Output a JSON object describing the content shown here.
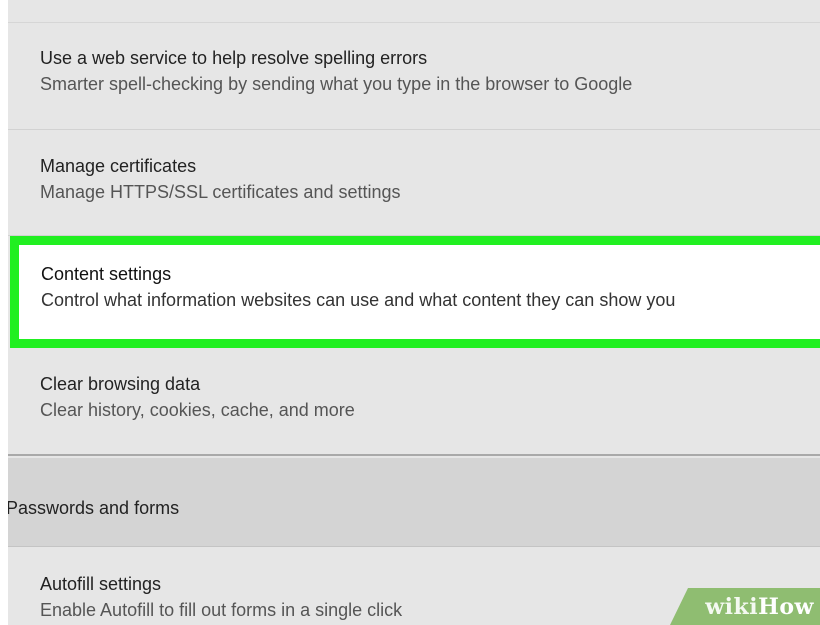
{
  "settings": {
    "spellcheck": {
      "title": "Use a web service to help resolve spelling errors",
      "subtitle": "Smarter spell-checking by sending what you type in the browser to Google"
    },
    "certificates": {
      "title": "Manage certificates",
      "subtitle": "Manage HTTPS/SSL certificates and settings"
    },
    "content_settings": {
      "title": "Content settings",
      "subtitle": "Control what information websites can use and what content they can show you",
      "highlight_color": "#21ef21"
    },
    "clear_browsing": {
      "title": "Clear browsing data",
      "subtitle": "Clear history, cookies, cache, and more"
    }
  },
  "passwords_section": {
    "title": "Passwords and forms",
    "autofill": {
      "title": "Autofill settings",
      "subtitle": "Enable Autofill to fill out forms in a single click"
    }
  },
  "watermark": {
    "part1": "wiki",
    "part2": "How"
  }
}
